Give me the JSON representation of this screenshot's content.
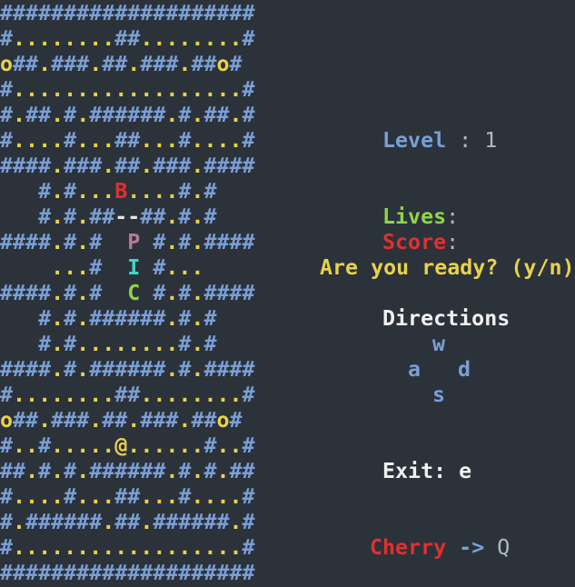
{
  "maze": {
    "rows": [
      "####################",
      "#........##........#",
      "o##.###.##.###.##o#",
      "#..................#",
      "#.##.#.######.#.##.#",
      "#....#...##...#....#",
      "####.###.##.###.####",
      "   #.#...B....#.#",
      "   #.#.##--##.#.#",
      "####.#.#  P #.#.####",
      "    ...#  I #...",
      "####.#.#  C #.#.####",
      "   #.#.######.#.#",
      "   #.#........#.#",
      "####.#.######.#.####",
      "#........##........#",
      "o##.###.##.###.##o#",
      "#..#.....@......#..#",
      "##.#.#.######.#.#.##",
      "#....#...##...#....#",
      "#.######.##.######.#",
      "#..................#",
      "####################"
    ]
  },
  "status": {
    "level_label": "Level",
    "level_sep": " : ",
    "level_value": "1",
    "lives_label": "Lives",
    "lives_sep": ":",
    "score_label": "Score",
    "score_sep": ":",
    "prompt": "Are you ready? (y/n)"
  },
  "directions": {
    "title": "Directions",
    "up": "w",
    "left": "a",
    "right": "d",
    "down": "s"
  },
  "exit": {
    "label": "Exit:",
    "key": "e"
  },
  "cherry": {
    "label": "Cherry",
    "arrow": "->",
    "symbol": "Q"
  },
  "colors": {
    "background": "#2c323a",
    "wall": "#7a9fd6",
    "dot": "#e8d24b",
    "blinky": "#e03030",
    "pinky": "#b77a9f",
    "inky": "#3fd6cc",
    "clyde": "#8fd44a"
  }
}
